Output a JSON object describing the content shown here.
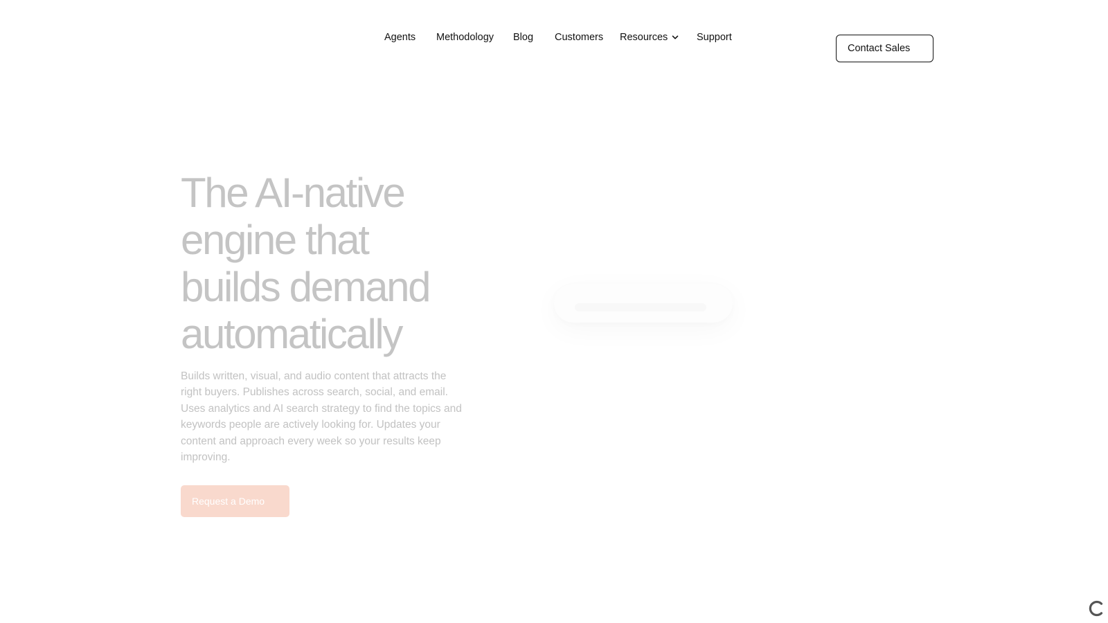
{
  "nav": {
    "items": [
      {
        "label": "Agents"
      },
      {
        "label": "Methodology"
      },
      {
        "label": "Blog"
      },
      {
        "label": "Customers"
      },
      {
        "label": "Resources",
        "has_dropdown": true,
        "icon": "chevron-down-icon"
      },
      {
        "label": "Support"
      }
    ],
    "contact_label": "Contact Sales"
  },
  "hero": {
    "title_lines": [
      "The AI-native",
      "engine that",
      "builds demand",
      "automatically"
    ],
    "description": "Builds written, visual, and audio content that attracts the right buyers. Publishes across search, social, and email. Uses analytics and AI search strategy to find the topics and keywords people are actively looking for. Updates your content and approach every week so your results keep improving.",
    "cta_label": "Request a Demo"
  },
  "loading": {
    "icon": "loading-spinner-icon"
  },
  "colors": {
    "text": "#111111",
    "hero_title": "#c4c4c4",
    "hero_desc": "#c2c2c2",
    "cta_bg": "#f9d9cd",
    "background": "#ffffff"
  }
}
